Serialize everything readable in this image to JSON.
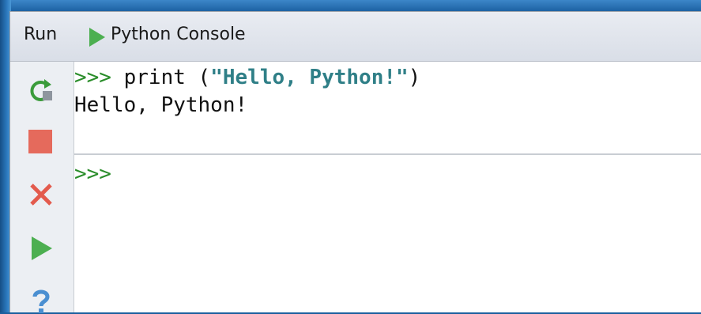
{
  "window": {
    "run_label": "Run",
    "title": "Python Console"
  },
  "toolbar": {
    "buttons": [
      {
        "name": "rerun-icon"
      },
      {
        "name": "stop-icon"
      },
      {
        "name": "close-icon"
      },
      {
        "name": "execute-icon"
      },
      {
        "name": "help-icon"
      }
    ]
  },
  "console": {
    "history": {
      "prompt": ">>>",
      "command_prefix": " print (",
      "command_string": "\"Hello, Python!\"",
      "command_suffix": ")",
      "output": "Hello, Python!"
    },
    "input": {
      "prompt": ">>>",
      "value": ""
    }
  },
  "colors": {
    "prompt": "#2a8d2a",
    "string": "#2f7f87",
    "run_green": "#4caf50",
    "stop_red": "#e56a5c"
  }
}
